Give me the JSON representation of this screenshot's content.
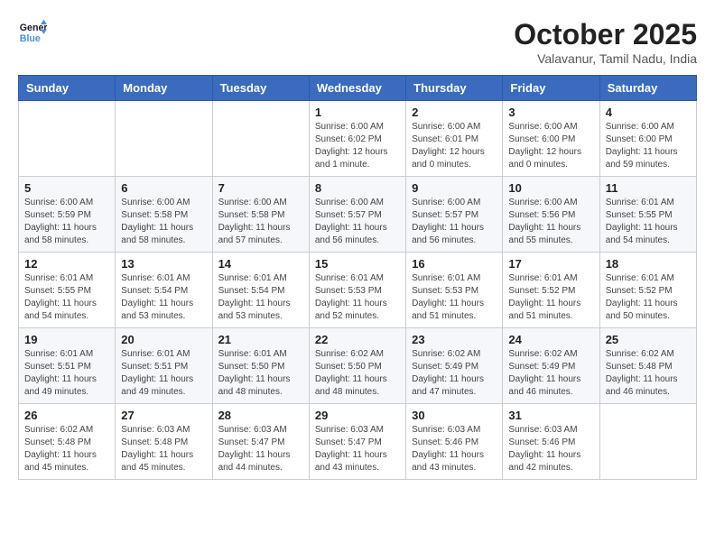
{
  "header": {
    "logo_line1": "General",
    "logo_line2": "Blue",
    "month": "October 2025",
    "location": "Valavanur, Tamil Nadu, India"
  },
  "weekdays": [
    "Sunday",
    "Monday",
    "Tuesday",
    "Wednesday",
    "Thursday",
    "Friday",
    "Saturday"
  ],
  "weeks": [
    [
      {
        "day": "",
        "info": ""
      },
      {
        "day": "",
        "info": ""
      },
      {
        "day": "",
        "info": ""
      },
      {
        "day": "1",
        "info": "Sunrise: 6:00 AM\nSunset: 6:02 PM\nDaylight: 12 hours\nand 1 minute."
      },
      {
        "day": "2",
        "info": "Sunrise: 6:00 AM\nSunset: 6:01 PM\nDaylight: 12 hours\nand 0 minutes."
      },
      {
        "day": "3",
        "info": "Sunrise: 6:00 AM\nSunset: 6:00 PM\nDaylight: 12 hours\nand 0 minutes."
      },
      {
        "day": "4",
        "info": "Sunrise: 6:00 AM\nSunset: 6:00 PM\nDaylight: 11 hours\nand 59 minutes."
      }
    ],
    [
      {
        "day": "5",
        "info": "Sunrise: 6:00 AM\nSunset: 5:59 PM\nDaylight: 11 hours\nand 58 minutes."
      },
      {
        "day": "6",
        "info": "Sunrise: 6:00 AM\nSunset: 5:58 PM\nDaylight: 11 hours\nand 58 minutes."
      },
      {
        "day": "7",
        "info": "Sunrise: 6:00 AM\nSunset: 5:58 PM\nDaylight: 11 hours\nand 57 minutes."
      },
      {
        "day": "8",
        "info": "Sunrise: 6:00 AM\nSunset: 5:57 PM\nDaylight: 11 hours\nand 56 minutes."
      },
      {
        "day": "9",
        "info": "Sunrise: 6:00 AM\nSunset: 5:57 PM\nDaylight: 11 hours\nand 56 minutes."
      },
      {
        "day": "10",
        "info": "Sunrise: 6:00 AM\nSunset: 5:56 PM\nDaylight: 11 hours\nand 55 minutes."
      },
      {
        "day": "11",
        "info": "Sunrise: 6:01 AM\nSunset: 5:55 PM\nDaylight: 11 hours\nand 54 minutes."
      }
    ],
    [
      {
        "day": "12",
        "info": "Sunrise: 6:01 AM\nSunset: 5:55 PM\nDaylight: 11 hours\nand 54 minutes."
      },
      {
        "day": "13",
        "info": "Sunrise: 6:01 AM\nSunset: 5:54 PM\nDaylight: 11 hours\nand 53 minutes."
      },
      {
        "day": "14",
        "info": "Sunrise: 6:01 AM\nSunset: 5:54 PM\nDaylight: 11 hours\nand 53 minutes."
      },
      {
        "day": "15",
        "info": "Sunrise: 6:01 AM\nSunset: 5:53 PM\nDaylight: 11 hours\nand 52 minutes."
      },
      {
        "day": "16",
        "info": "Sunrise: 6:01 AM\nSunset: 5:53 PM\nDaylight: 11 hours\nand 51 minutes."
      },
      {
        "day": "17",
        "info": "Sunrise: 6:01 AM\nSunset: 5:52 PM\nDaylight: 11 hours\nand 51 minutes."
      },
      {
        "day": "18",
        "info": "Sunrise: 6:01 AM\nSunset: 5:52 PM\nDaylight: 11 hours\nand 50 minutes."
      }
    ],
    [
      {
        "day": "19",
        "info": "Sunrise: 6:01 AM\nSunset: 5:51 PM\nDaylight: 11 hours\nand 49 minutes."
      },
      {
        "day": "20",
        "info": "Sunrise: 6:01 AM\nSunset: 5:51 PM\nDaylight: 11 hours\nand 49 minutes."
      },
      {
        "day": "21",
        "info": "Sunrise: 6:01 AM\nSunset: 5:50 PM\nDaylight: 11 hours\nand 48 minutes."
      },
      {
        "day": "22",
        "info": "Sunrise: 6:02 AM\nSunset: 5:50 PM\nDaylight: 11 hours\nand 48 minutes."
      },
      {
        "day": "23",
        "info": "Sunrise: 6:02 AM\nSunset: 5:49 PM\nDaylight: 11 hours\nand 47 minutes."
      },
      {
        "day": "24",
        "info": "Sunrise: 6:02 AM\nSunset: 5:49 PM\nDaylight: 11 hours\nand 46 minutes."
      },
      {
        "day": "25",
        "info": "Sunrise: 6:02 AM\nSunset: 5:48 PM\nDaylight: 11 hours\nand 46 minutes."
      }
    ],
    [
      {
        "day": "26",
        "info": "Sunrise: 6:02 AM\nSunset: 5:48 PM\nDaylight: 11 hours\nand 45 minutes."
      },
      {
        "day": "27",
        "info": "Sunrise: 6:03 AM\nSunset: 5:48 PM\nDaylight: 11 hours\nand 45 minutes."
      },
      {
        "day": "28",
        "info": "Sunrise: 6:03 AM\nSunset: 5:47 PM\nDaylight: 11 hours\nand 44 minutes."
      },
      {
        "day": "29",
        "info": "Sunrise: 6:03 AM\nSunset: 5:47 PM\nDaylight: 11 hours\nand 43 minutes."
      },
      {
        "day": "30",
        "info": "Sunrise: 6:03 AM\nSunset: 5:46 PM\nDaylight: 11 hours\nand 43 minutes."
      },
      {
        "day": "31",
        "info": "Sunrise: 6:03 AM\nSunset: 5:46 PM\nDaylight: 11 hours\nand 42 minutes."
      },
      {
        "day": "",
        "info": ""
      }
    ]
  ]
}
